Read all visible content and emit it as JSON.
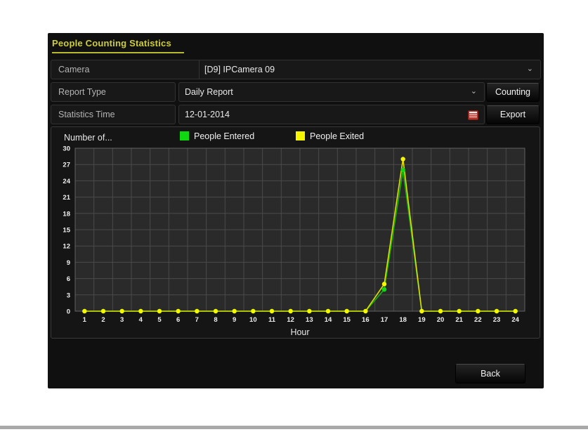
{
  "panel": {
    "title": "People Counting Statistics"
  },
  "form": {
    "camera": {
      "label": "Camera",
      "value": "[D9] IPCamera 09"
    },
    "report_type": {
      "label": "Report Type",
      "value": "Daily Report"
    },
    "statistics_time": {
      "label": "Statistics Time",
      "value": "12-01-2014"
    }
  },
  "buttons": {
    "counting": "Counting",
    "export": "Export",
    "back": "Back"
  },
  "icons": {
    "camera_dropdown": "chevron-down-icon",
    "report_dropdown": "chevron-down-icon",
    "statistics_time_calendar": "calendar-icon"
  },
  "colors": {
    "accent_yellow": "#cdcd3c",
    "series_entered": "#12b212",
    "series_entered_dot": "#10d810",
    "series_exited": "#dede00",
    "series_exited_dot": "#f6f600",
    "grid": "#4a4a4a",
    "plot_bg": "#2a2a2a"
  },
  "chart_data": {
    "type": "line",
    "title": "",
    "ylabel": "Number of...",
    "xlabel": "Hour",
    "x": [
      1,
      2,
      3,
      4,
      5,
      6,
      7,
      8,
      9,
      10,
      11,
      12,
      13,
      14,
      15,
      16,
      17,
      18,
      19,
      20,
      21,
      22,
      23,
      24
    ],
    "ylim": [
      0,
      30
    ],
    "ytick_step": 3,
    "grid": true,
    "legend_position": "top",
    "series": [
      {
        "name": "People Entered",
        "color": "#12b212",
        "dot_color": "#10d810",
        "values": [
          0,
          0,
          0,
          0,
          0,
          0,
          0,
          0,
          0,
          0,
          0,
          0,
          0,
          0,
          0,
          0,
          4,
          26,
          0,
          0,
          0,
          0,
          0,
          0
        ]
      },
      {
        "name": "People Exited",
        "color": "#dede00",
        "dot_color": "#f6f600",
        "values": [
          0,
          0,
          0,
          0,
          0,
          0,
          0,
          0,
          0,
          0,
          0,
          0,
          0,
          0,
          0,
          0,
          5,
          28,
          0,
          0,
          0,
          0,
          0,
          0
        ]
      }
    ]
  }
}
